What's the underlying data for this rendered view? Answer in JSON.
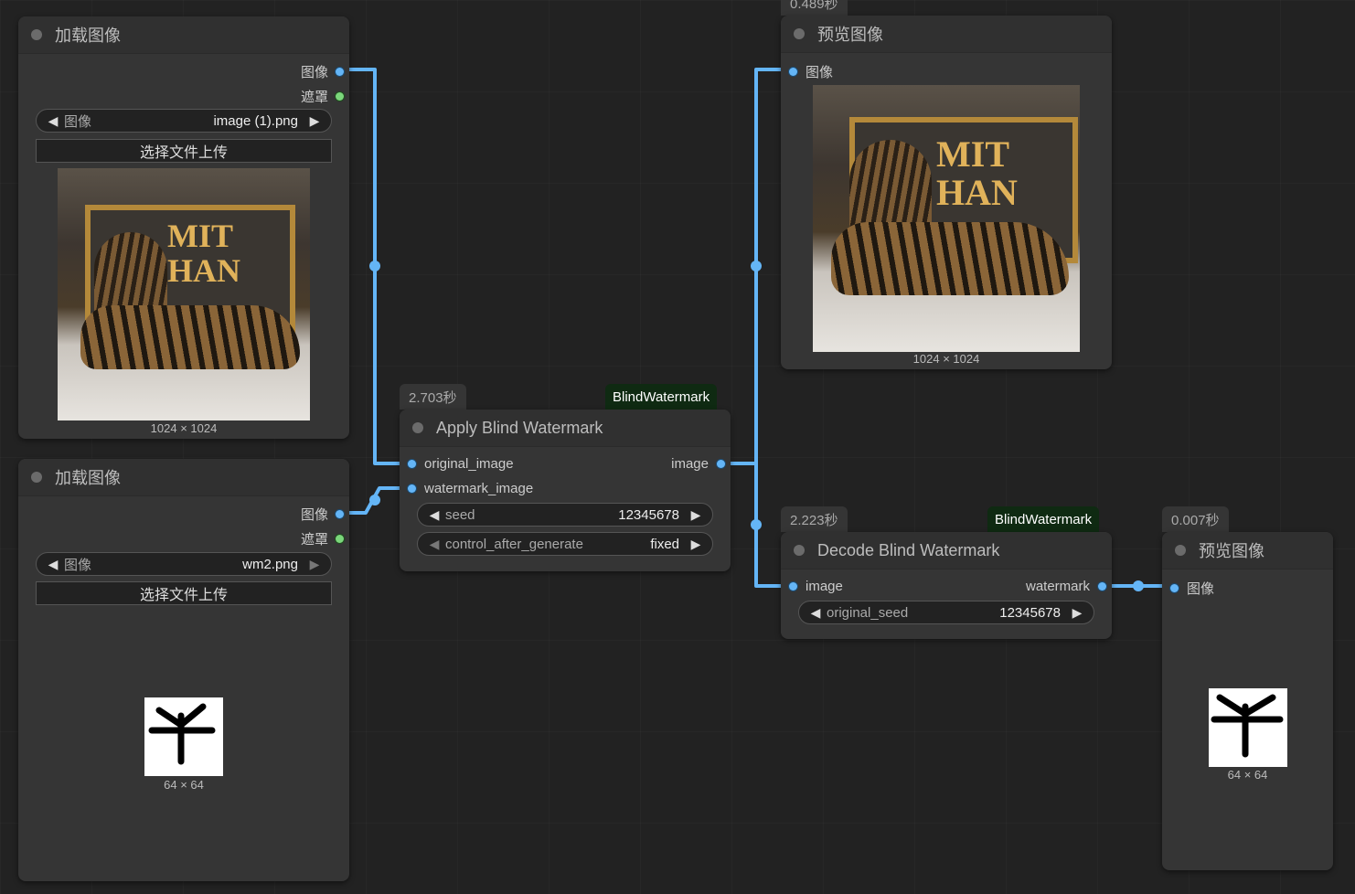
{
  "nodes": {
    "load1": {
      "title": "加载图像",
      "out_image": "图像",
      "out_mask": "遮罩",
      "widget_label": "图像",
      "widget_value": "image (1).png",
      "upload": "选择文件上传",
      "dims": "1024 × 1024"
    },
    "load2": {
      "title": "加载图像",
      "out_image": "图像",
      "out_mask": "遮罩",
      "widget_label": "图像",
      "widget_value": "wm2.png",
      "upload": "选择文件上传",
      "dims": "64 × 64"
    },
    "apply": {
      "time": "2.703秒",
      "tag": "BlindWatermark",
      "title": "Apply Blind Watermark",
      "in_original": "original_image",
      "in_watermark": "watermark_image",
      "out_image": "image",
      "seed_label": "seed",
      "seed_value": "12345678",
      "cag_label": "control_after_generate",
      "cag_value": "fixed"
    },
    "preview1": {
      "time": "0.489秒",
      "title": "预览图像",
      "in_image": "图像",
      "dims": "1024 × 1024"
    },
    "decode": {
      "time": "2.223秒",
      "tag": "BlindWatermark",
      "title": "Decode Blind Watermark",
      "in_image": "image",
      "out_watermark": "watermark",
      "seed_label": "original_seed",
      "seed_value": "12345678"
    },
    "preview2": {
      "time": "0.007秒",
      "title": "预览图像",
      "in_image": "图像",
      "dims": "64 × 64"
    }
  },
  "image_text": {
    "line1": "MIT",
    "line2": "HAN"
  },
  "colors": {
    "link": "#64b5f6",
    "node_bg": "#353535",
    "canvas_bg": "#222222",
    "tag_bg": "#0f2a12"
  }
}
